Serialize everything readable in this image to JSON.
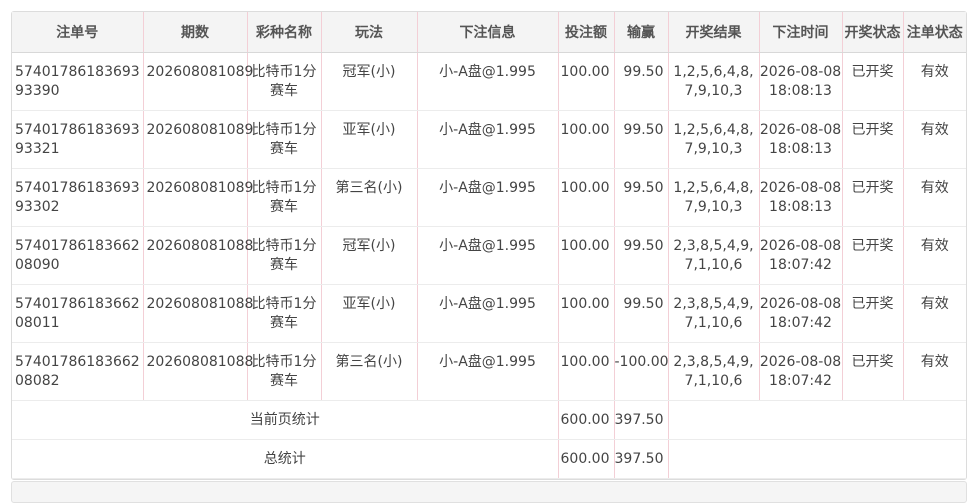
{
  "headers": [
    "注单号",
    "期数",
    "彩种名称",
    "玩法",
    "下注信息",
    "投注额",
    "输赢",
    "开奖结果",
    "下注时间",
    "开奖状态",
    "注单状态"
  ],
  "rows": [
    {
      "order_no": "5740178618369393390",
      "period": "202608081089",
      "lottery": "比特币1分赛车",
      "play": "冠军(小)",
      "bet_info": "小-A盘@1.995",
      "amount": "100.00",
      "win_loss": "99.50",
      "result": "1,2,5,6,4,8,7,9,10,3",
      "time": "2026-08-08 18:08:13",
      "draw_status": "已开奖",
      "bet_status": "有效"
    },
    {
      "order_no": "5740178618369393321",
      "period": "202608081089",
      "lottery": "比特币1分赛车",
      "play": "亚军(小)",
      "bet_info": "小-A盘@1.995",
      "amount": "100.00",
      "win_loss": "99.50",
      "result": "1,2,5,6,4,8,7,9,10,3",
      "time": "2026-08-08 18:08:13",
      "draw_status": "已开奖",
      "bet_status": "有效"
    },
    {
      "order_no": "5740178618369393302",
      "period": "202608081089",
      "lottery": "比特币1分赛车",
      "play": "第三名(小)",
      "bet_info": "小-A盘@1.995",
      "amount": "100.00",
      "win_loss": "99.50",
      "result": "1,2,5,6,4,8,7,9,10,3",
      "time": "2026-08-08 18:08:13",
      "draw_status": "已开奖",
      "bet_status": "有效"
    },
    {
      "order_no": "5740178618366208090",
      "period": "202608081088",
      "lottery": "比特币1分赛车",
      "play": "冠军(小)",
      "bet_info": "小-A盘@1.995",
      "amount": "100.00",
      "win_loss": "99.50",
      "result": "2,3,8,5,4,9,7,1,10,6",
      "time": "2026-08-08 18:07:42",
      "draw_status": "已开奖",
      "bet_status": "有效"
    },
    {
      "order_no": "5740178618366208011",
      "period": "202608081088",
      "lottery": "比特币1分赛车",
      "play": "亚军(小)",
      "bet_info": "小-A盘@1.995",
      "amount": "100.00",
      "win_loss": "99.50",
      "result": "2,3,8,5,4,9,7,1,10,6",
      "time": "2026-08-08 18:07:42",
      "draw_status": "已开奖",
      "bet_status": "有效"
    },
    {
      "order_no": "5740178618366208082",
      "period": "202608081088",
      "lottery": "比特币1分赛车",
      "play": "第三名(小)",
      "bet_info": "小-A盘@1.995",
      "amount": "100.00",
      "win_loss": "-100.00",
      "result": "2,3,8,5,4,9,7,1,10,6",
      "time": "2026-08-08 18:07:42",
      "draw_status": "已开奖",
      "bet_status": "有效"
    }
  ],
  "summary": [
    {
      "label": "当前页统计",
      "amount": "600.00",
      "win_loss": "397.50"
    },
    {
      "label": "总统计",
      "amount": "600.00",
      "win_loss": "397.50"
    }
  ]
}
